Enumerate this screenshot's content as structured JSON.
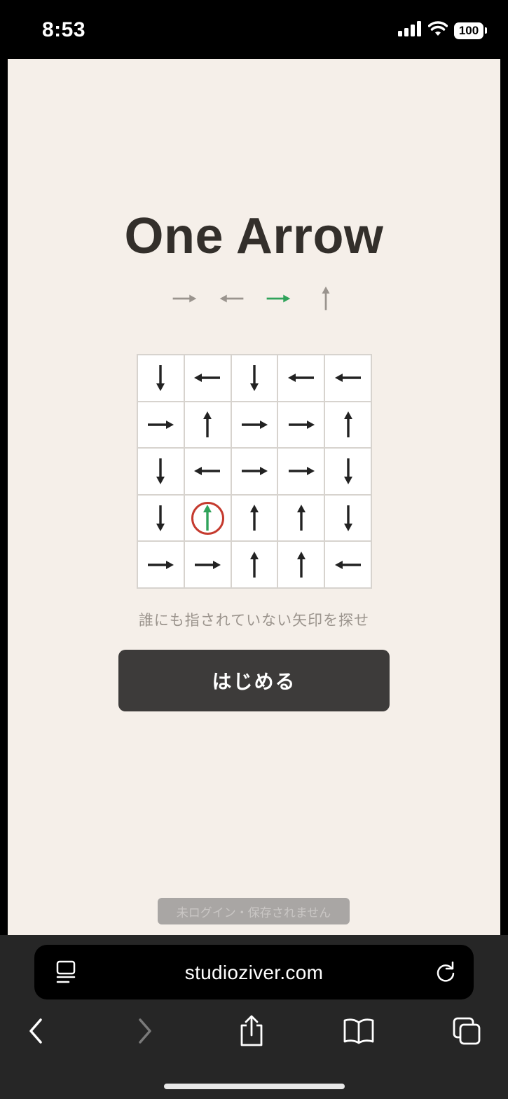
{
  "status_bar": {
    "time": "8:53",
    "battery": "100"
  },
  "app": {
    "title": "One Arrow",
    "title_arrows": [
      {
        "direction": "right",
        "color": "#9a948e"
      },
      {
        "direction": "left",
        "color": "#9a948e"
      },
      {
        "direction": "right",
        "color": "#2fa35a"
      },
      {
        "direction": "up",
        "color": "#9a948e"
      }
    ],
    "grid": [
      [
        "down",
        "left",
        "down",
        "left",
        "left"
      ],
      [
        "right",
        "up",
        "right",
        "right",
        "up"
      ],
      [
        "down",
        "left",
        "right",
        "right",
        "down"
      ],
      [
        "down",
        "up",
        "up",
        "up",
        "down"
      ],
      [
        "right",
        "right",
        "up",
        "up",
        "left"
      ]
    ],
    "highlighted_cell": {
      "row": 3,
      "col": 1,
      "arrow_color": "#2fa35a",
      "ring_color": "#c53a2e"
    },
    "arrow_color": "#222222",
    "instruction": "誰にも指されていない矢印を探せ",
    "start_button_label": "はじめる",
    "login_notice": "未ログイン・保存されません"
  },
  "browser": {
    "url": "studioziver.com",
    "icons": [
      "reader-icon",
      "reload-icon",
      "back-icon",
      "forward-icon",
      "share-icon",
      "bookmarks-icon",
      "tabs-icon"
    ]
  }
}
